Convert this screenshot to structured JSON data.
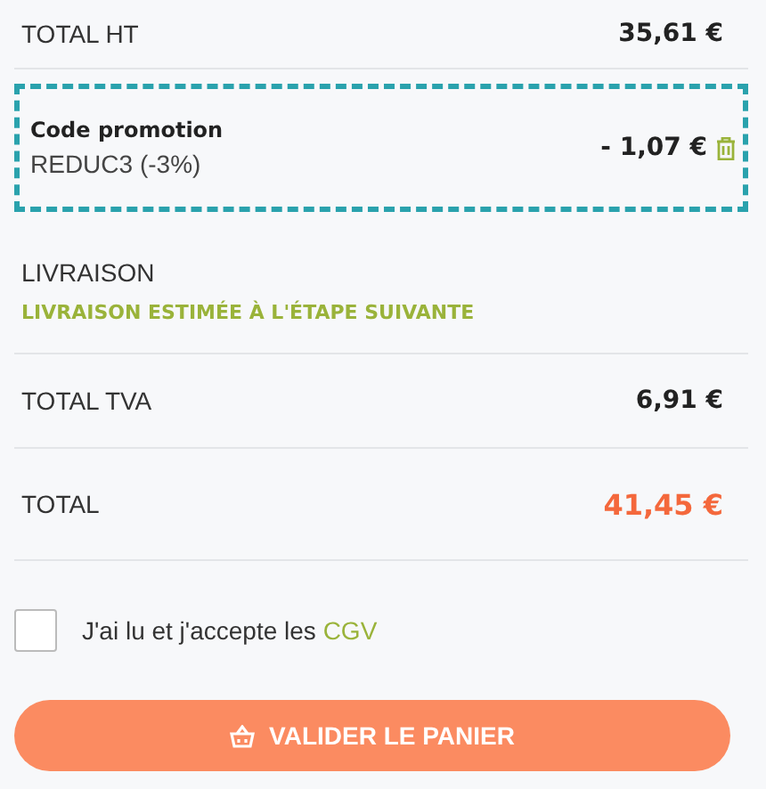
{
  "total_ht": {
    "label": "TOTAL HT",
    "value": "35,61 €"
  },
  "promo": {
    "title": "Code promotion",
    "code": "REDUC3 (-3%)",
    "value": "- 1,07 €"
  },
  "delivery": {
    "label": "LIVRAISON",
    "note": "LIVRAISON ESTIMÉE À L'ÉTAPE SUIVANTE"
  },
  "total_tva": {
    "label": "TOTAL TVA",
    "value": "6,91 €"
  },
  "total": {
    "label": "TOTAL",
    "value": "41,45 €"
  },
  "terms": {
    "text": "J'ai lu et j'accepte les",
    "link": "CGV",
    "checked": false
  },
  "submit": {
    "label": "VALIDER LE PANIER"
  }
}
